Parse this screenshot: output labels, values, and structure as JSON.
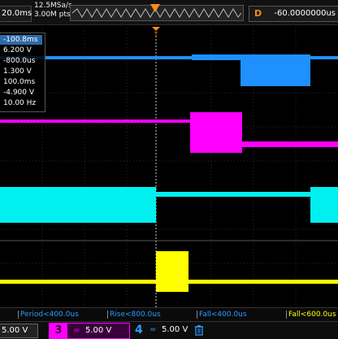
{
  "header": {
    "timebase": "20.0ms",
    "sample_rate": "12.5MSa/s",
    "memory_depth": "3.00M pts",
    "delay_label": "D",
    "delay_value": "-60.0000000us"
  },
  "measurements_panel": {
    "items": [
      "-100.8ms",
      "6.200 V",
      "-800.0us",
      "1.300 V",
      "100.0ms",
      "-4.900 V",
      "10.00 Hz"
    ]
  },
  "measure_strip": {
    "items": [
      {
        "label": "Period<400.0us",
        "color": "#2a9bff"
      },
      {
        "label": "Rise<800.0us",
        "color": "#2a9bff"
      },
      {
        "label": "Fall<400.0us",
        "color": "#2a9bff"
      },
      {
        "label": "Fall<600.0us",
        "color": "#ffff00"
      }
    ]
  },
  "channels": {
    "ch1": {
      "scale": "5.00 V",
      "color": "#ffff00"
    },
    "ch3": {
      "number": "3",
      "coupling": "=",
      "scale": "5.00 V",
      "color": "#ff00ff"
    },
    "ch4": {
      "number": "4",
      "coupling": "=",
      "scale": "5.00 V",
      "color": "#2a9bff"
    }
  },
  "icons": [
    "trigger-position-marker-icon",
    "trash-icon"
  ]
}
